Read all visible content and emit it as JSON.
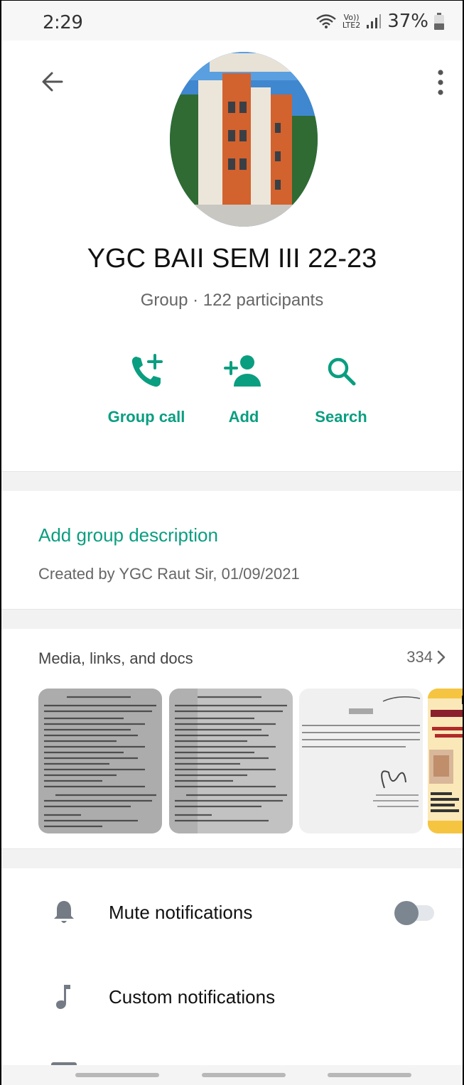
{
  "status_bar": {
    "time": "2:29",
    "network_top": "Vo))",
    "network_bottom": "LTE2",
    "battery": "37%"
  },
  "header": {
    "back_icon": "arrow-left-icon",
    "menu_icon": "more-vert-icon"
  },
  "group": {
    "name": "YGC BAII SEM III 22-23",
    "subtitle": "Group · 122 participants"
  },
  "actions": [
    {
      "label": "Group call",
      "icon": "add-call-icon"
    },
    {
      "label": "Add",
      "icon": "add-person-icon"
    },
    {
      "label": "Search",
      "icon": "search-icon"
    }
  ],
  "description": {
    "add_label": "Add group description",
    "created_by": "Created by YGC Raut Sir, 01/09/2021"
  },
  "media": {
    "title": "Media, links, and docs",
    "count": "334"
  },
  "settings": [
    {
      "label": "Mute notifications",
      "icon": "bell-icon",
      "enabled": false
    },
    {
      "label": "Custom notifications",
      "icon": "music-note-icon"
    }
  ],
  "colors": {
    "accent": "#0a9e80",
    "background": "#ffffff",
    "band": "#f2f2f2"
  }
}
